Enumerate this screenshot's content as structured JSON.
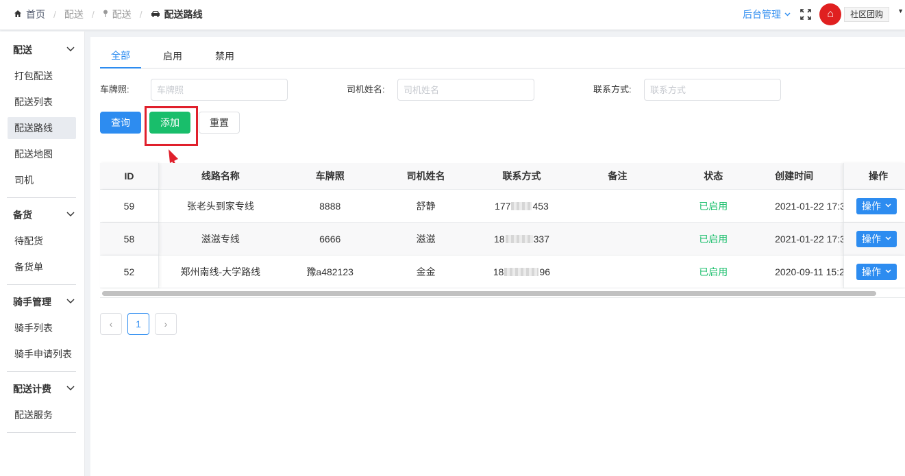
{
  "breadcrumb": {
    "home": "首页",
    "level1": "配送",
    "level2": "配送",
    "current": "配送路线"
  },
  "header": {
    "admin_menu": "后台管理",
    "community_tag": "社区团购",
    "logo_text": "⌂"
  },
  "sidebar": {
    "groups": [
      {
        "title": "配送",
        "items": [
          "打包配送",
          "配送列表",
          "配送路线",
          "配送地图",
          "司机"
        ]
      },
      {
        "title": "备货",
        "items": [
          "待配货",
          "备货单"
        ]
      },
      {
        "title": "骑手管理",
        "items": [
          "骑手列表",
          "骑手申请列表"
        ]
      },
      {
        "title": "配送计费",
        "items": [
          "配送服务"
        ]
      }
    ],
    "active_item": "配送路线"
  },
  "tabs": [
    "全部",
    "启用",
    "禁用"
  ],
  "active_tab": "全部",
  "filters": {
    "plate_label": "车牌照:",
    "plate_placeholder": "车牌照",
    "driver_label": "司机姓名:",
    "driver_placeholder": "司机姓名",
    "contact_label": "联系方式:",
    "contact_placeholder": "联系方式"
  },
  "buttons": {
    "query": "查询",
    "add": "添加",
    "reset": "重置"
  },
  "table": {
    "columns": [
      "ID",
      "线路名称",
      "车牌照",
      "司机姓名",
      "联系方式",
      "备注",
      "状态",
      "创建时间",
      "操作"
    ],
    "rows": [
      {
        "id": "59",
        "name": "张老头到家专线",
        "plate": "8888",
        "driver": "舒静",
        "phone_prefix": "177",
        "phone_suffix": "453",
        "note": "",
        "status": "已启用",
        "created": "2021-01-22 17:3",
        "op": "操作"
      },
      {
        "id": "58",
        "name": "滋滋专线",
        "plate": "6666",
        "driver": "滋滋",
        "phone_prefix": "18",
        "phone_suffix": "337",
        "note": "",
        "status": "已启用",
        "created": "2021-01-22 17:3",
        "op": "操作"
      },
      {
        "id": "52",
        "name": "郑州南线-大学路线",
        "plate": "豫a482123",
        "driver": "金金",
        "phone_prefix": "18",
        "phone_suffix": "96",
        "note": "",
        "status": "已启用",
        "created": "2020-09-11 15:2",
        "op": "操作"
      }
    ]
  },
  "pagination": {
    "prev": "‹",
    "current": "1",
    "next": "›"
  },
  "colors": {
    "primary": "#2d8cf0",
    "success": "#19be6b",
    "highlight": "#e0202c"
  }
}
